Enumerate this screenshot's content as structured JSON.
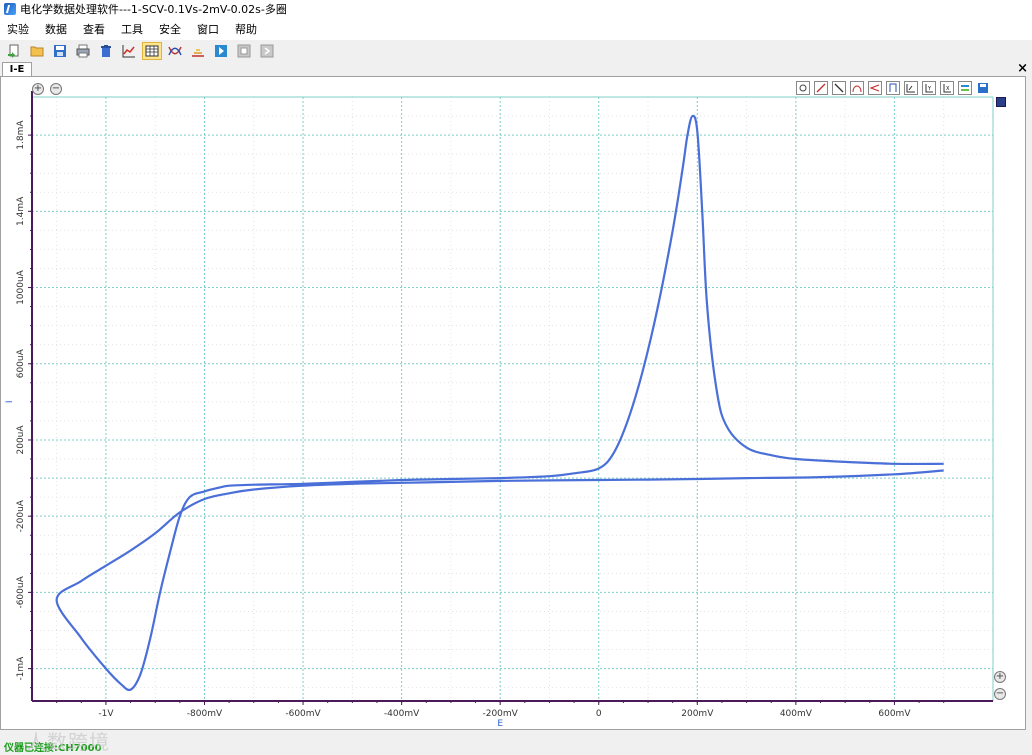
{
  "window": {
    "title": "电化学数据处理软件---1-SCV-0.1Vs-2mV-0.02s-多圈"
  },
  "menu": {
    "items": [
      {
        "label": "实验"
      },
      {
        "label": "数据"
      },
      {
        "label": "查看"
      },
      {
        "label": "工具"
      },
      {
        "label": "安全"
      },
      {
        "label": "窗口"
      },
      {
        "label": "帮助"
      }
    ]
  },
  "toolbar": {
    "icons": [
      "new-icon",
      "open-folder-icon",
      "save-icon",
      "print-icon",
      "delete-icon",
      "chart-icon",
      "table-icon",
      "curve-cross-icon",
      "peak-icon",
      "run-icon",
      "stop-icon",
      "skip-icon"
    ]
  },
  "tab": {
    "label": "I-E",
    "close": "×"
  },
  "plot_tools": {
    "icons": [
      "settings-icon",
      "line-icon",
      "slope-icon",
      "arc-icon",
      "split-icon",
      "peak-mark-icon",
      "xy-icon",
      "y-axis-icon",
      "x-axis-icon",
      "legend-icon",
      "save-icon"
    ]
  },
  "colors": {
    "curve": "#4a6fd8",
    "grid": "#7fd0c8",
    "axis": "#4a1a5a",
    "legend": "#2a3e8a"
  },
  "status": {
    "text": "仪器已连接:CH7000"
  },
  "watermark": "人数跨境",
  "chart_data": {
    "type": "line",
    "title": "",
    "xlabel": "E",
    "ylabel": "I",
    "xlim": [
      -1.15,
      0.8
    ],
    "ylim": [
      -1.17,
      2.0
    ],
    "x_ticks": [
      {
        "v": -1.0,
        "label": "-1V"
      },
      {
        "v": -0.8,
        "label": "-800mV"
      },
      {
        "v": -0.6,
        "label": "-600mV"
      },
      {
        "v": -0.4,
        "label": "-400mV"
      },
      {
        "v": -0.2,
        "label": "-200mV"
      },
      {
        "v": 0.0,
        "label": "0"
      },
      {
        "v": 0.2,
        "label": "200mV"
      },
      {
        "v": 0.4,
        "label": "400mV"
      },
      {
        "v": 0.6,
        "label": "600mV"
      }
    ],
    "y_ticks": [
      {
        "v": -1.0,
        "label": "-1mA"
      },
      {
        "v": -0.6,
        "label": "-600uA"
      },
      {
        "v": -0.2,
        "label": "-200uA"
      },
      {
        "v": 0.2,
        "label": "200uA"
      },
      {
        "v": 0.6,
        "label": "600uA"
      },
      {
        "v": 1.0,
        "label": "1000uA"
      },
      {
        "v": 1.4,
        "label": "1.4mA"
      },
      {
        "v": 1.8,
        "label": "1.8mA"
      }
    ],
    "series": [
      {
        "name": "",
        "x": [
          0.7,
          0.6,
          0.45,
          0.3,
          0.2,
          0.1,
          0.0,
          -0.1,
          -0.2,
          -0.3,
          -0.4,
          -0.5,
          -0.6,
          -0.7,
          -0.75,
          -0.8,
          -0.85,
          -0.9,
          -0.95,
          -1.0,
          -1.05,
          -1.1,
          -1.05,
          -1.0,
          -0.97,
          -0.95,
          -0.93,
          -0.91,
          -0.89,
          -0.87,
          -0.85,
          -0.83,
          -0.8,
          -0.77,
          -0.75,
          -0.7,
          -0.6,
          -0.5,
          -0.4,
          -0.3,
          -0.2,
          -0.1,
          -0.05,
          0.0,
          0.03,
          0.06,
          0.09,
          0.12,
          0.15,
          0.17,
          0.18,
          0.19,
          0.2,
          0.21,
          0.22,
          0.24,
          0.26,
          0.3,
          0.35,
          0.4,
          0.5,
          0.6,
          0.7
        ],
        "y": [
          0.04,
          0.02,
          0.005,
          0.0,
          -0.005,
          -0.008,
          -0.01,
          -0.012,
          -0.015,
          -0.02,
          -0.025,
          -0.03,
          -0.04,
          -0.06,
          -0.08,
          -0.11,
          -0.18,
          -0.29,
          -0.38,
          -0.46,
          -0.54,
          -0.64,
          -0.84,
          -1.0,
          -1.08,
          -1.11,
          -1.03,
          -0.84,
          -0.6,
          -0.39,
          -0.2,
          -0.1,
          -0.07,
          -0.05,
          -0.04,
          -0.035,
          -0.03,
          -0.02,
          -0.01,
          -0.005,
          0.0,
          0.01,
          0.025,
          0.05,
          0.13,
          0.31,
          0.57,
          0.9,
          1.3,
          1.62,
          1.8,
          1.9,
          1.82,
          1.4,
          0.9,
          0.45,
          0.27,
          0.16,
          0.12,
          0.1,
          0.085,
          0.075,
          0.075
        ]
      }
    ]
  }
}
